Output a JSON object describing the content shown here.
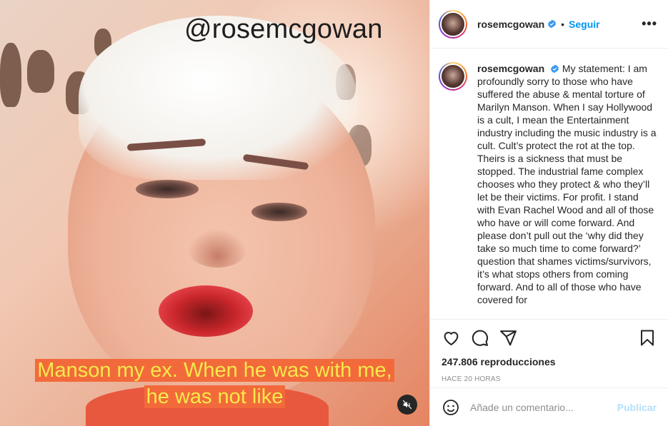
{
  "post": {
    "watermark": "@rosemcgowan",
    "subtitles": [
      "Manson my ex. When he was with me,",
      "he was not like"
    ],
    "mute_icon": "speaker-muted-icon"
  },
  "header": {
    "username": "rosemcgowan",
    "verified_icon": "verified-badge-icon",
    "separator": "•",
    "follow_label": "Seguir",
    "more_label": "•••"
  },
  "caption": {
    "username": "rosemcgowan",
    "text": "My statement: I am profoundly sorry to those who have suffered the abuse & mental torture of Marilyn Manson. When I say Hollywood is a cult, I mean the Entertainment industry including the music industry is a cult. Cult’s protect the rot at the top. Theirs is a sickness that must be stopped. The industrial fame complex chooses who they protect & who they’ll let be their victims. For profit. I stand with Evan Rachel Wood and all of those who have or will come forward. And please don’t pull out the ‘why did they take so much time to come forward?’ question that shames victims/survivors, it’s what stops others from coming forward. And to all of those who have covered for"
  },
  "actions": {
    "like_icon": "heart-icon",
    "comment_icon": "comment-icon",
    "share_icon": "paper-plane-icon",
    "save_icon": "bookmark-icon",
    "views_count": "247.806",
    "views_label": "reproducciones",
    "timestamp": "Hace 20 horas"
  },
  "comment_box": {
    "emoji_icon": "smiley-icon",
    "placeholder": "Añade un comentario...",
    "post_label": "Publicar"
  },
  "colors": {
    "accent": "#0095f6",
    "post_disabled": "#b2dffc",
    "subtitle_bg": "#f26a3b",
    "subtitle_text": "#f7e94a"
  }
}
